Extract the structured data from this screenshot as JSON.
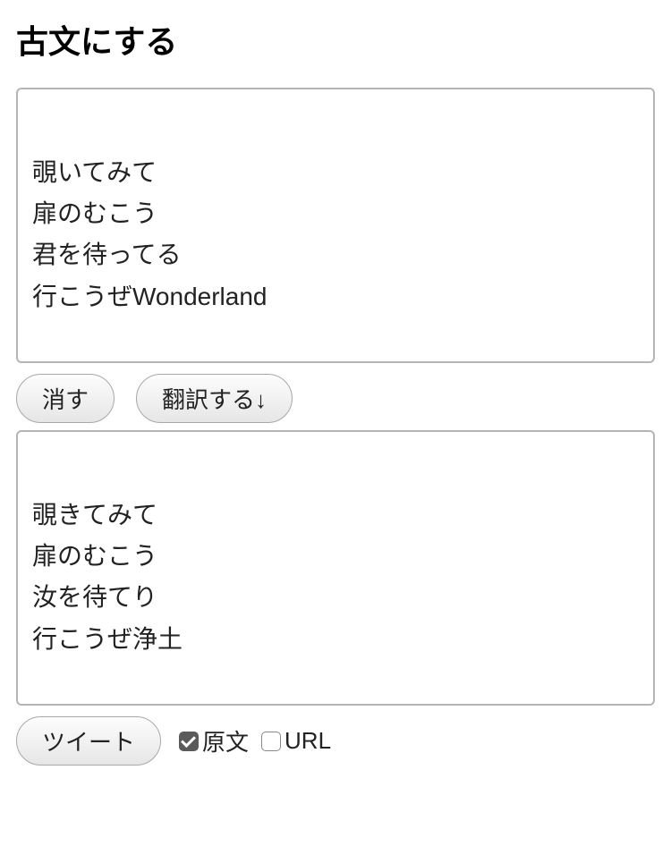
{
  "header": {
    "title": "古文にする"
  },
  "input": {
    "text": "覗いてみて\n扉のむこう\n君を待ってる\n行こうぜWonderland"
  },
  "actions": {
    "clear_label": "消す",
    "translate_label": "翻訳する↓"
  },
  "output": {
    "text": "覗きてみて\n扉のむこう\n汝を待てり\n行こうぜ浄土"
  },
  "share": {
    "tweet_label": "ツイート",
    "checkbox_original_label": "原文",
    "checkbox_original_checked": true,
    "checkbox_url_label": "URL",
    "checkbox_url_checked": false
  }
}
